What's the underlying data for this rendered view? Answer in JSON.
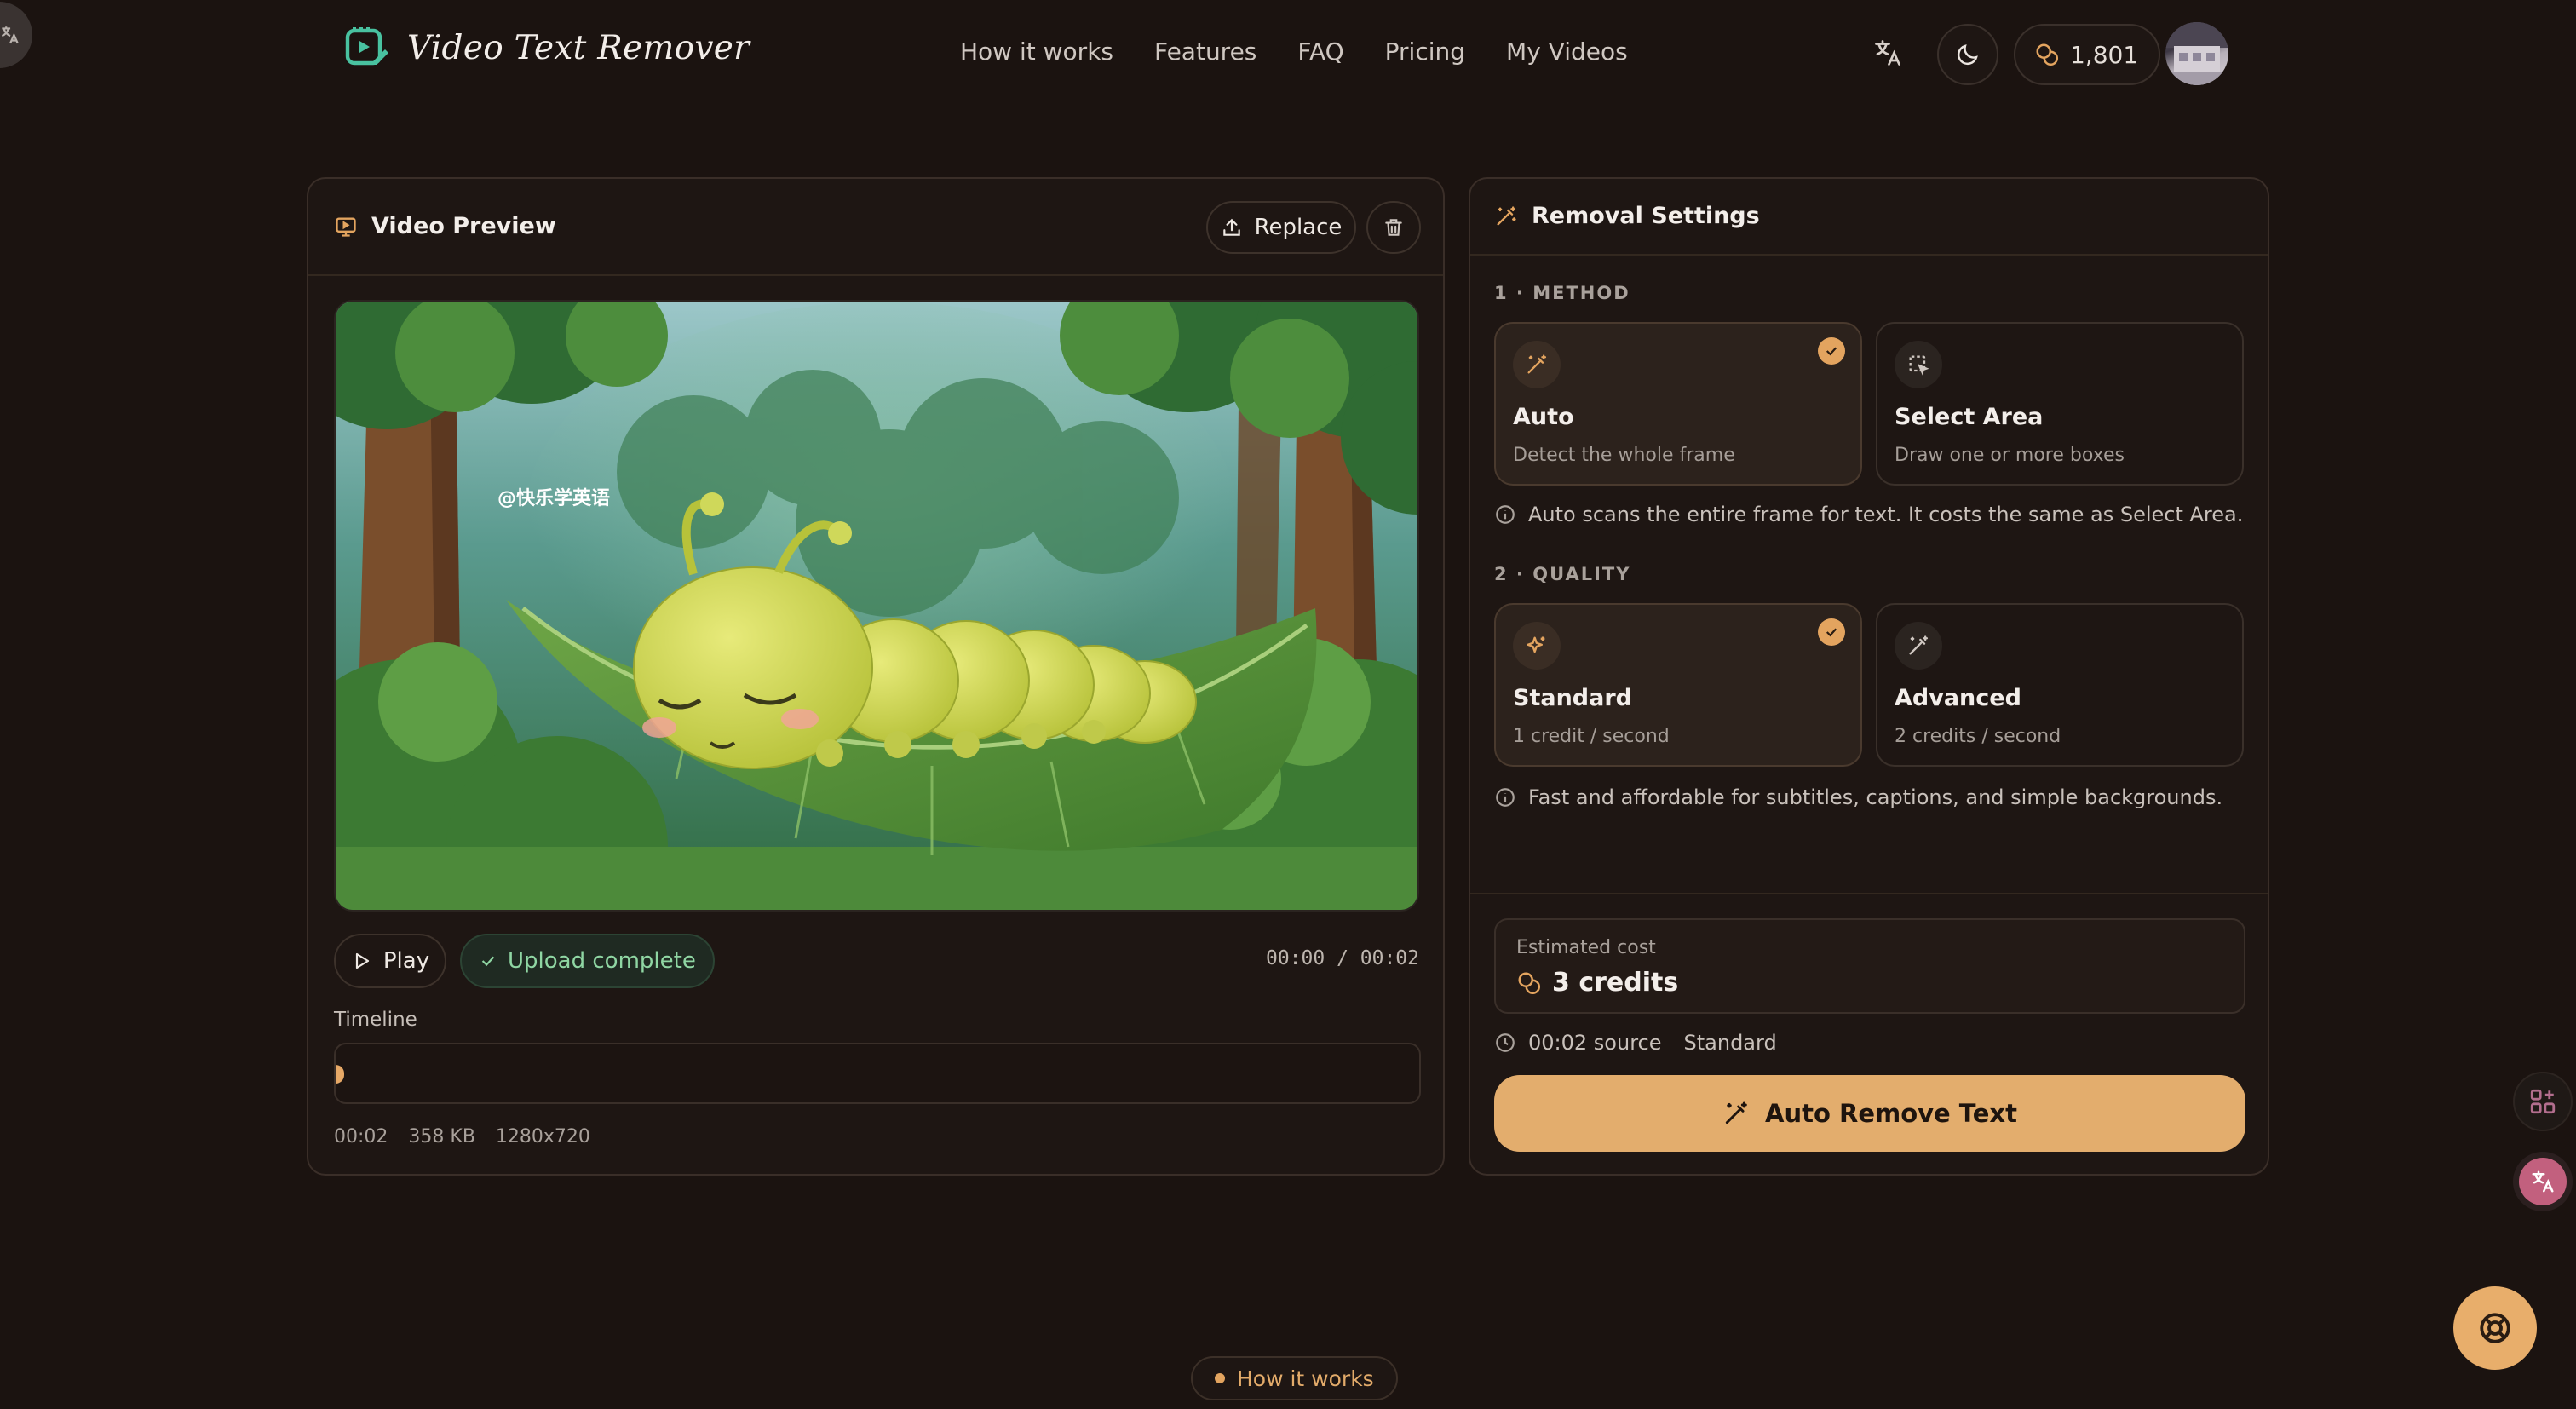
{
  "app": {
    "title": "Video Text Remover"
  },
  "nav": {
    "items": [
      "How it works",
      "Features",
      "FAQ",
      "Pricing",
      "My Videos"
    ]
  },
  "header": {
    "credits": "1,801"
  },
  "preview": {
    "title": "Video Preview",
    "replace_label": "Replace",
    "watermark_text": "@快乐学英语",
    "play_label": "Play",
    "upload_status": "Upload complete",
    "time_readout": "00:00 / 00:02",
    "timeline_label": "Timeline",
    "progress": 0,
    "meta": {
      "duration": "00:02",
      "size": "358 KB",
      "resolution": "1280x720"
    }
  },
  "settings": {
    "title": "Removal Settings",
    "method": {
      "label": "1 · METHOD",
      "options": [
        {
          "title": "Auto",
          "sub": "Detect the whole frame",
          "selected": true
        },
        {
          "title": "Select Area",
          "sub": "Draw one or more boxes",
          "selected": false
        }
      ],
      "info": "Auto scans the entire frame for text. It costs the same as Select Area."
    },
    "quality": {
      "label": "2 · QUALITY",
      "options": [
        {
          "title": "Standard",
          "sub": "1 credit / second",
          "selected": true
        },
        {
          "title": "Advanced",
          "sub": "2 credits / second",
          "selected": false
        }
      ],
      "info": "Fast and affordable for subtitles, captions, and simple backgrounds."
    },
    "cost": {
      "label": "Estimated cost",
      "value": "3 credits"
    },
    "source": {
      "duration": "00:02 source",
      "quality": "Standard"
    },
    "cta_label": "Auto Remove Text"
  },
  "footer": {
    "pill_label": "How it works"
  },
  "colors": {
    "accent": "#e3ad6d",
    "success": "#8fd6a3",
    "background": "#1b1310"
  }
}
